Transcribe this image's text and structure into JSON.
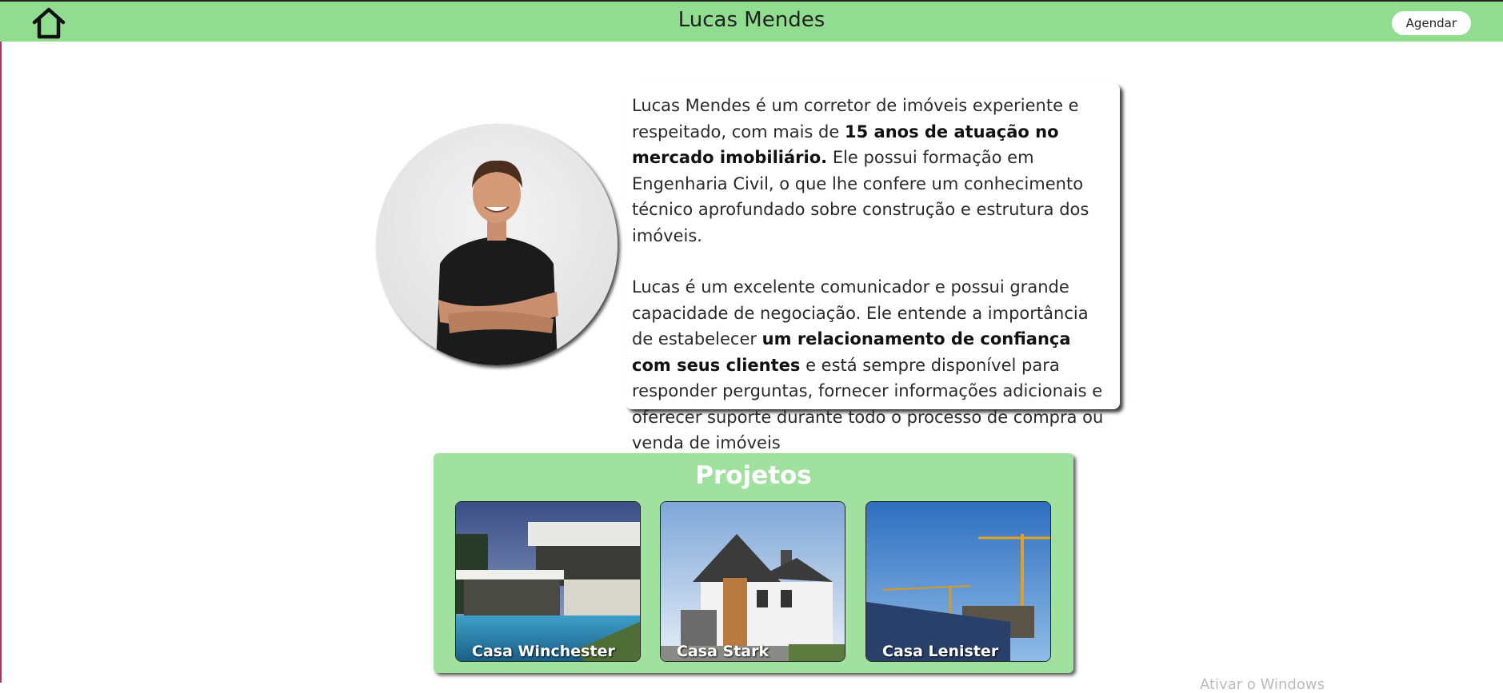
{
  "header": {
    "title": "Lucas Mendes",
    "agendar_label": "Agendar"
  },
  "bio": {
    "p1_a": "Lucas Mendes é um corretor de imóveis experiente e respeitado, com mais de ",
    "p1_bold": "15 anos de atuação no mercado imobiliário.",
    "p1_b": " Ele possui formação em Engenharia Civil, o que lhe confere um conhecimento técnico aprofundado sobre construção e estrutura dos imóveis.",
    "p2_a": "Lucas é um excelente comunicador e possui grande capacidade de negociação. Ele entende a importância de estabelecer ",
    "p2_bold": "um relacionamento de confiança com seus clientes",
    "p2_b": " e está sempre disponível para responder perguntas, fornecer informações adicionais e oferecer suporte durante todo o processo de compra ou venda de imóveis"
  },
  "projects": {
    "title": "Projetos",
    "items": [
      {
        "label": "Casa Winchester"
      },
      {
        "label": "Casa Stark"
      },
      {
        "label": "Casa Lenister"
      }
    ]
  },
  "colors": {
    "header_bg": "#90dd90",
    "projects_bg": "#a0e1a0"
  },
  "watermark": "Ativar o Windows"
}
